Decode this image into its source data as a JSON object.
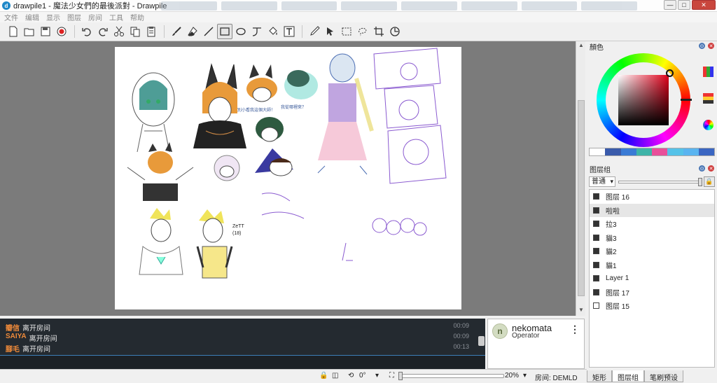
{
  "window": {
    "title": "drawpile1 - 魔法少女們的最後派對 - Drawpile",
    "app_icon": "drawpile-icon",
    "controls": {
      "minimize": "—",
      "maximize": "□",
      "close": "✕"
    }
  },
  "menu": [
    "文件",
    "编辑",
    "显示",
    "图层",
    "房间",
    "工具",
    "帮助"
  ],
  "toolbar": {
    "tools": [
      "new-file-icon",
      "open-folder-icon",
      "save-icon",
      "record-icon",
      "undo-icon",
      "redo-icon",
      "cut-icon",
      "copy-icon",
      "paste-icon",
      "brush-icon",
      "eraser-icon",
      "line-icon",
      "rectangle-icon",
      "ellipse-icon",
      "bezier-icon",
      "fill-icon",
      "text-icon",
      "color-picker-icon",
      "laser-pointer-icon",
      "select-rect-icon",
      "select-lasso-icon",
      "crop-icon",
      "annotation-icon"
    ],
    "active": "rectangle-icon"
  },
  "chat": {
    "messages": [
      {
        "user": "瓣信",
        "text": "离开房间",
        "time": "00:09"
      },
      {
        "user": "SAIYA",
        "text": "离开房间",
        "time": "00:09"
      },
      {
        "user": "腳毛",
        "text": "离开房间",
        "time": "00:13"
      }
    ]
  },
  "users": {
    "name": "nekomata",
    "role": "Operator",
    "avatar_letter": "n"
  },
  "status": {
    "rotation": "0°",
    "zoom": "20%",
    "room": "房间: DEMLD"
  },
  "dock": {
    "color_panel_title": "顏色",
    "swatches": [
      "#ffffff",
      "#3a5bab",
      "#3a7bd5",
      "#3eb4a8",
      "#e8509a",
      "#55c2e8",
      "#5ab4f0",
      "#3b66c2"
    ],
    "layers_panel_title": "图层组",
    "blend_mode": "普通",
    "layers": [
      {
        "name": "图层 16",
        "visible": true,
        "selected": false
      },
      {
        "name": "啦啦",
        "visible": true,
        "selected": true
      },
      {
        "name": "拉3",
        "visible": true,
        "selected": false
      },
      {
        "name": "貓3",
        "visible": true,
        "selected": false
      },
      {
        "name": "貓2",
        "visible": true,
        "selected": false
      },
      {
        "name": "貓1",
        "visible": true,
        "selected": false
      },
      {
        "name": "Layer 1",
        "visible": true,
        "selected": false
      },
      {
        "name": "图层 17",
        "visible": true,
        "selected": false
      },
      {
        "name": "图层 15",
        "visible": false,
        "selected": false
      }
    ],
    "tabs": [
      "矩形",
      "图层组",
      "笔刷预设"
    ],
    "active_tab": "图层组"
  },
  "canvas": {
    "annotations": [
      "ZeTT",
      "(18)",
      "別小看我這個大師！",
      "我從哪裡來？"
    ]
  }
}
